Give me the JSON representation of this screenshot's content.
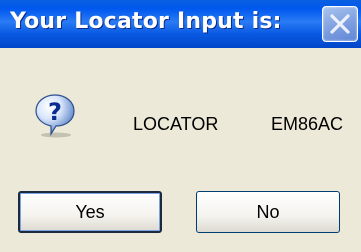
{
  "dialog": {
    "title": "Your Locator Input is:",
    "icon": "question-icon",
    "message": {
      "label": "LOCATOR",
      "value": "EM86AC"
    },
    "buttons": {
      "yes_label": "Yes",
      "no_label": "No"
    },
    "close_icon": "close-icon"
  },
  "colors": {
    "titlebar": "#0058ee",
    "background": "#ece9d8",
    "close_button": "#7d9ee0",
    "button_border": "#003c74"
  }
}
